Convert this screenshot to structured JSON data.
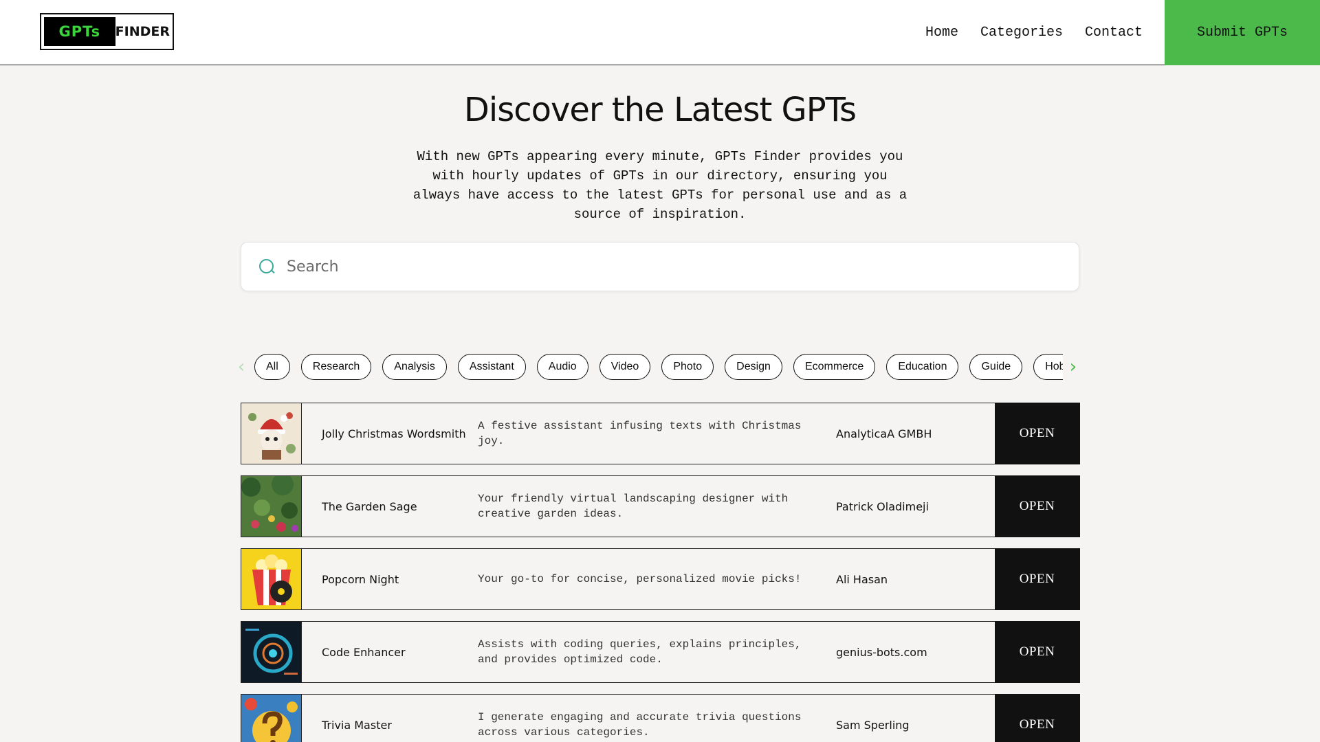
{
  "header": {
    "logo_left": "GPTs",
    "logo_right": "FINDER",
    "nav": [
      "Home",
      "Categories",
      "Contact"
    ],
    "submit_label": "Submit GPTs"
  },
  "hero": {
    "title": "Discover the Latest GPTs",
    "text": "With new GPTs appearing every minute, GPTs Finder provides you with hourly updates of GPTs in our directory, ensuring you always have access to the latest GPTs for personal use and as a source of inspiration."
  },
  "search": {
    "placeholder": "Search"
  },
  "categories": [
    "All",
    "Research",
    "Analysis",
    "Assistant",
    "Audio",
    "Video",
    "Photo",
    "Design",
    "Ecommerce",
    "Education",
    "Guide",
    "Hobby"
  ],
  "colors": {
    "accent": "#4cba4a",
    "open_bg": "#111111",
    "search_icon": "#3aa89a"
  },
  "gpts": [
    {
      "name": "Jolly Christmas Wordsmith",
      "description": "A festive assistant infusing texts with Christmas joy.",
      "author": "AnalyticaA GMBH",
      "action": "OPEN"
    },
    {
      "name": "The Garden Sage",
      "description": "Your friendly virtual landscaping designer with creative garden ideas.",
      "author": "Patrick Oladimeji",
      "action": "OPEN"
    },
    {
      "name": "Popcorn Night",
      "description": "Your go-to for concise, personalized movie picks!",
      "author": "Ali Hasan",
      "action": "OPEN"
    },
    {
      "name": "Code Enhancer",
      "description": "Assists with coding queries, explains principles, and provides optimized code.",
      "author": "genius-bots.com",
      "action": "OPEN"
    },
    {
      "name": "Trivia Master",
      "description": "I generate engaging and accurate trivia questions across various categories.",
      "author": "Sam Sperling",
      "action": "OPEN"
    }
  ]
}
